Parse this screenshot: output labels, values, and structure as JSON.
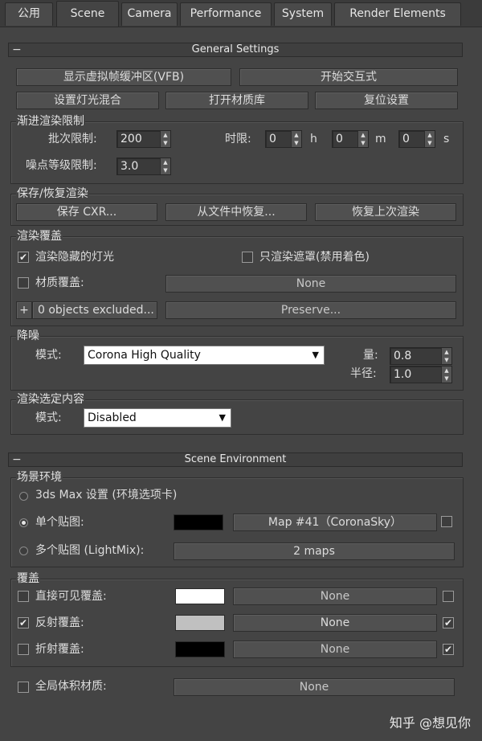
{
  "tabs": [
    "公用",
    "Scene",
    "Camera",
    "Performance",
    "System",
    "Render Elements"
  ],
  "active_tab": "Scene",
  "general": {
    "title": "General Settings",
    "btn_vfb": "显示虚拟帧缓冲区(VFB)",
    "btn_interactive": "开始交互式",
    "btn_lightmix": "设置灯光混合",
    "btn_mtl_lib": "打开材质库",
    "btn_reset": "复位设置",
    "progressive": {
      "label": "渐进渲染限制",
      "pass_limit_label": "批次限制:",
      "pass_limit": "200",
      "time_label": "时限:",
      "h": "0",
      "h_unit": "h",
      "m": "0",
      "m_unit": "m",
      "s": "0",
      "s_unit": "s",
      "noise_label": "噪点等级限制:",
      "noise": "3.0"
    },
    "save": {
      "label": "保存/恢复渲染",
      "btn_save": "保存 CXR...",
      "btn_restore_file": "从文件中恢复...",
      "btn_restore_last": "恢复上次渲染"
    },
    "override": {
      "label": "渲染覆盖",
      "hidden_lights": "渲染隐藏的灯光",
      "mask_only": "只渲染遮罩(禁用着色)",
      "mtl_override": "材质覆盖:",
      "mtl_none": "None",
      "plus": "+",
      "excluded": "0 objects excluded...",
      "preserve": "Preserve..."
    },
    "denoise": {
      "label": "降噪",
      "mode_label": "模式:",
      "mode": "Corona High Quality",
      "amount_label": "量:",
      "amount": "0.8",
      "radius_label": "半径:",
      "radius": "1.0"
    },
    "selected": {
      "label": "渲染选定内容",
      "mode_label": "模式:",
      "mode": "Disabled"
    }
  },
  "scene_env": {
    "title": "Scene Environment",
    "env": {
      "label": "场景环境",
      "opt_max": "3ds Max 设置 (环境选项卡)",
      "opt_single": "单个贴图:",
      "single_map": "Map #41（CoronaSky）",
      "opt_multi": "多个贴图 (LightMix):",
      "multi_maps": "2 maps"
    },
    "overrides": {
      "label": "覆盖",
      "direct": "直接可见覆盖:",
      "reflect": "反射覆盖:",
      "refract": "折射覆盖:",
      "none": "None",
      "global_volume": "全局体积材质:",
      "global_none": "None"
    },
    "colors": {
      "single_map": "#000000",
      "direct": "#ffffff",
      "reflect": "#c0c0c0",
      "refract": "#000000"
    }
  },
  "watermark": "知乎 @想见你"
}
